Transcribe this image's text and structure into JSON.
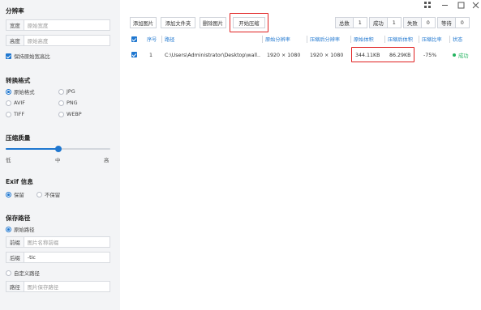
{
  "sidebar": {
    "resolution": {
      "title": "分辨率",
      "width_label": "宽度",
      "width_placeholder": "原始宽度",
      "height_label": "高度",
      "height_placeholder": "原始高度",
      "keep_ratio": "保持原始宽高比"
    },
    "format": {
      "title": "转换格式",
      "options": [
        "原始格式",
        "JPG",
        "AVIF",
        "PNG",
        "TIFF",
        "WEBP"
      ],
      "selected": "原始格式"
    },
    "quality": {
      "title": "压缩质量",
      "low": "低",
      "mid": "中",
      "high": "高",
      "level": 0.5
    },
    "exif": {
      "title": "Exif 信息",
      "keep": "保留",
      "discard": "不保留",
      "selected": "保留"
    },
    "save": {
      "title": "保存路径",
      "original": "原始路径",
      "prefix_label": "前缀",
      "prefix_placeholder": "图片名称前缀",
      "suffix_label": "后缀",
      "suffix_value": "-tic",
      "custom": "自定义路径",
      "path_label": "路径",
      "path_placeholder": "图片保存路径"
    }
  },
  "toolbar": {
    "add_image": "添加图片",
    "add_folder": "添加文件夹",
    "delete_image": "删除图片",
    "start": "开始压缩"
  },
  "stats": {
    "total_label": "总数",
    "total": "1",
    "success_label": "成功",
    "success": "1",
    "fail_label": "失败",
    "fail": "0",
    "wait_label": "等待",
    "wait": "0"
  },
  "table": {
    "headers": [
      "序号",
      "路径",
      "原始分辨率",
      "压缩后分辨率",
      "原始体积",
      "压缩后体积",
      "压缩比率",
      "状态"
    ],
    "rows": [
      {
        "index": "1",
        "path": "C:\\Users\\Administrator\\Desktop\\wall...",
        "orig_res": "1920 × 1080",
        "new_res": "1920 × 1080",
        "orig_size": "344.11KB",
        "new_size": "86.29KB",
        "ratio": "-75%",
        "status": "成功"
      }
    ]
  },
  "colors": {
    "accent": "#1f77d0",
    "highlight": "#e02020",
    "success": "#22b35e"
  }
}
